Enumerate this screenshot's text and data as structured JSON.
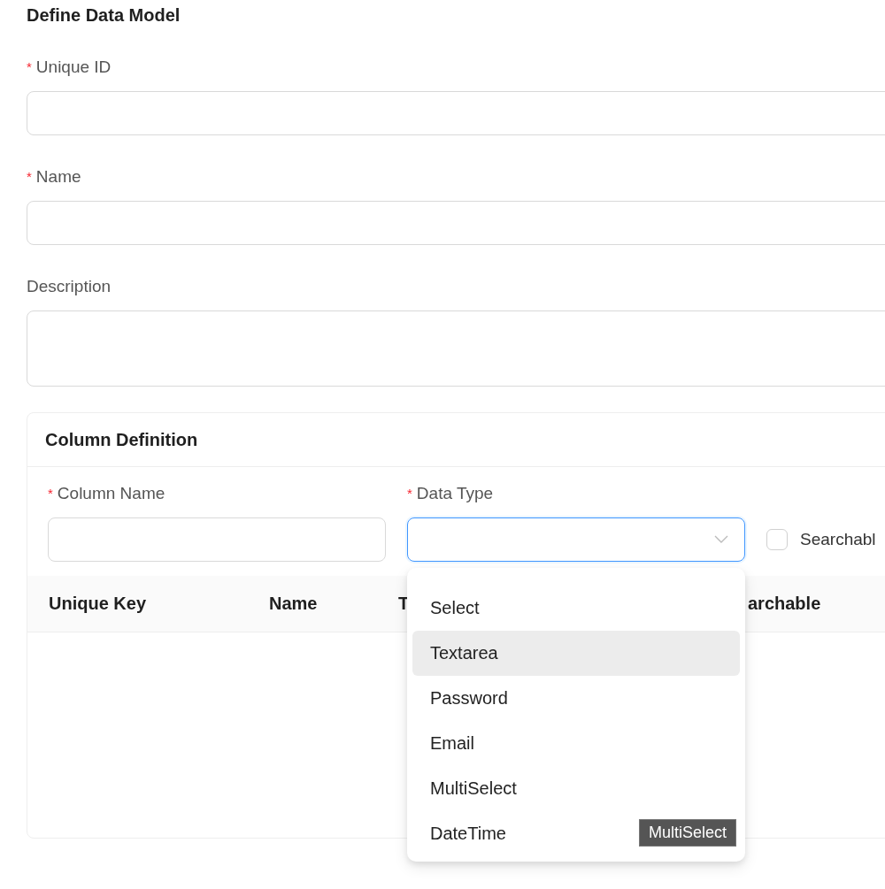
{
  "title": "Define Data Model",
  "fields": [
    {
      "label": "Unique ID",
      "required_mark": "*",
      "kind": "input"
    },
    {
      "label": "Name",
      "required_mark": "*",
      "kind": "input"
    },
    {
      "label": "Description",
      "kind": "textarea"
    }
  ],
  "column_definition": {
    "title": "Column Definition",
    "column_name": {
      "label": "Column Name",
      "required_mark": "*"
    },
    "data_type": {
      "label": "Data Type",
      "required_mark": "*",
      "focused": true,
      "options": [
        {
          "label": "Select",
          "selected": false
        },
        {
          "label": "Textarea",
          "selected": true
        },
        {
          "label": "Password",
          "selected": false
        },
        {
          "label": "Email",
          "selected": false
        },
        {
          "label": "MultiSelect",
          "selected": false
        },
        {
          "label": "DateTime",
          "selected": false
        }
      ]
    },
    "searchable": {
      "label": "Searchabl",
      "checked": false
    },
    "table": {
      "columns": [
        "Unique Key",
        "Name",
        "T",
        "archable"
      ]
    }
  },
  "tooltip": "MultiSelect"
}
